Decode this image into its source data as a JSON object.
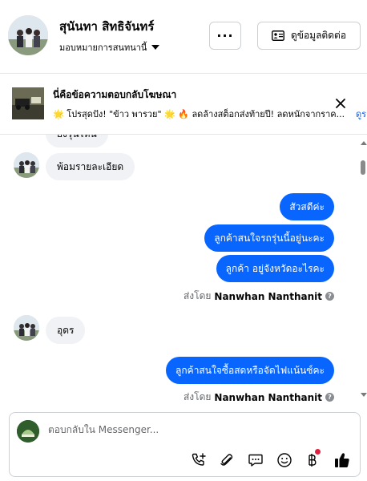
{
  "header": {
    "contact_name": "สุนันทา สิทธิจันทร์",
    "assign_label": "มอบหมายการสนทนานี้",
    "more_label": "···",
    "contact_info_label": "ดูข้อมูลติดต่อ"
  },
  "ad_reply": {
    "title": "นี่คือข้อความตอบกลับโฆษณา",
    "text": "🌟 โปรสุดปัง! \"ข้าว พารวย\" 🌟 🔥 ลดล้างสต็อกส่งท้ายปี! ลดหนักจากราค...",
    "see_more": "ดูร"
  },
  "conversation": {
    "partial_top": "ยังรุ่นไหน",
    "incoming_1": "พ้อมรายละเอียด",
    "outgoing_1": "สัวสดีค่ะ",
    "outgoing_2": "ลูกค้าสนใจรถรุ่นนี้อยู่นะคะ",
    "outgoing_3": "ลูกค้า อยู่จังหวัดอะไรคะ",
    "sent_by_prefix": "ส่งโดย",
    "sender_name": "Nanwhan Nanthanit",
    "incoming_2": "อุดร",
    "outgoing_4": "ลูกค้าสนใจซื้อสดหรือจัดไฟแน้นซ์คะ"
  },
  "composer": {
    "placeholder": "ตอบกลับใน Messenger..."
  },
  "colors": {
    "accent": "#0866ff",
    "bubble_in": "#f0f2f5",
    "badge": "#e41e3f"
  },
  "icons": [
    "more-icon",
    "contact-card-icon",
    "close-icon",
    "info-icon",
    "call-plus-icon",
    "paperclip-icon",
    "speech-bubble-icon",
    "emoji-icon",
    "baht-icon",
    "thumbs-up-icon"
  ]
}
